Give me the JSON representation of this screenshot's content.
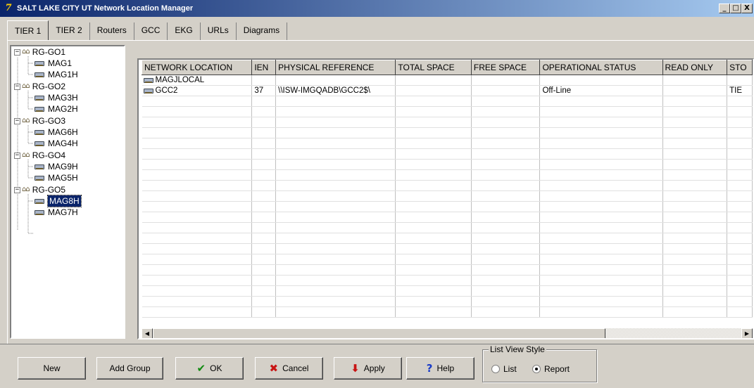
{
  "window": {
    "title": "SALT LAKE CITY UT Network Location Manager",
    "buttons": [
      "_",
      "□",
      "X"
    ]
  },
  "tabs": [
    {
      "label": "TIER 1",
      "active": true
    },
    {
      "label": "TIER 2",
      "active": false
    },
    {
      "label": "Routers",
      "active": false
    },
    {
      "label": "GCC",
      "active": false
    },
    {
      "label": "EKG",
      "active": false
    },
    {
      "label": "URLs",
      "active": false
    },
    {
      "label": "Diagrams",
      "active": false
    }
  ],
  "tree": {
    "groups": [
      {
        "label": "RG-GO1",
        "children": [
          "MAG1",
          "MAG1H"
        ]
      },
      {
        "label": "RG-GO2",
        "children": [
          "MAG3H",
          "MAG2H"
        ]
      },
      {
        "label": "RG-GO3",
        "children": [
          "MAG6H",
          "MAG4H"
        ]
      },
      {
        "label": "RG-GO4",
        "children": [
          "MAG9H",
          "MAG5H"
        ]
      },
      {
        "label": "RG-GO5",
        "children": [
          "MAG8H",
          "MAG7H"
        ]
      }
    ],
    "selected": "MAG8H"
  },
  "grid": {
    "columns": [
      "NETWORK LOCATION",
      "IEN",
      "PHYSICAL REFERENCE",
      "TOTAL SPACE",
      "FREE SPACE",
      "OPERATIONAL STATUS",
      "READ ONLY",
      "STO"
    ],
    "rows": [
      [
        "MAGJLOCAL",
        "",
        "",
        "",
        "",
        "",
        "",
        ""
      ],
      [
        "GCC2",
        "37",
        "\\\\ISW-IMGQADB\\GCC2$\\",
        "",
        "",
        "Off-Line",
        "",
        "TIE"
      ]
    ]
  },
  "buttons": {
    "new": "New",
    "add_group": "Add Group",
    "ok": "OK",
    "cancel": "Cancel",
    "apply": "Apply",
    "help": "Help"
  },
  "list_view_style": {
    "legend": "List View Style",
    "options": [
      {
        "label": "List",
        "selected": false
      },
      {
        "label": "Report",
        "selected": true
      }
    ]
  }
}
